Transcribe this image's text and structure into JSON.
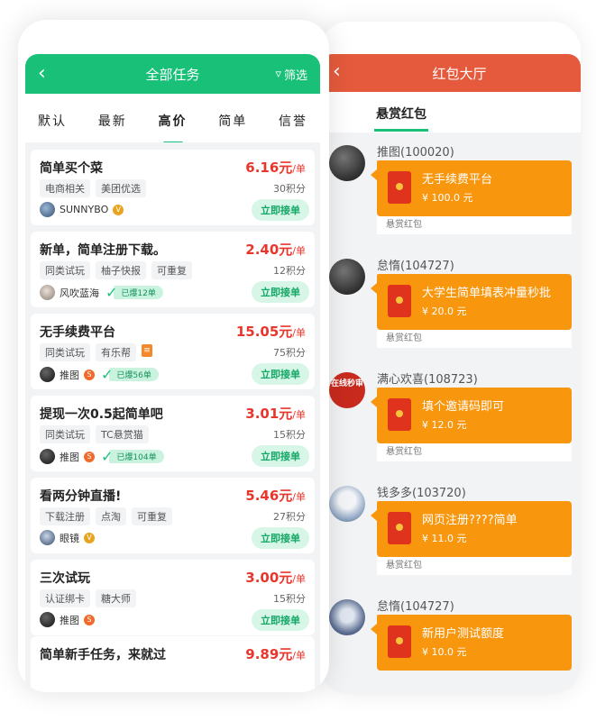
{
  "left": {
    "back_icon": "chevron-left-icon",
    "title": "全部任务",
    "filter_label": "筛选",
    "tabs": [
      "默认",
      "最新",
      "高价",
      "简单",
      "信誉"
    ],
    "active_tab": "高价",
    "tasks": [
      {
        "title": "简单买个菜",
        "price": "6.16元",
        "unit": "/单",
        "tags": [
          "电商相关",
          "美团优选"
        ],
        "points": "30积分",
        "user": "SUNNYBO",
        "badge": "V",
        "sold": "",
        "action": "立即接单"
      },
      {
        "title": "新单，简单注册下载。",
        "price": "2.40元",
        "unit": "/单",
        "tags": [
          "同类试玩",
          "柚子快报",
          "可重复"
        ],
        "points": "12积分",
        "user": "风吹蓝海",
        "badge": "",
        "sold": "已爆12单",
        "action": "立即接单"
      },
      {
        "title": "无手续费平台",
        "price": "15.05元",
        "unit": "/单",
        "tags": [
          "同类试玩",
          "有乐帮"
        ],
        "points": "75积分",
        "user": "推图",
        "badge": "S",
        "sold": "已爆56单",
        "action": "立即接单"
      },
      {
        "title": "提现一次0.5起简单吧",
        "price": "3.01元",
        "unit": "/单",
        "tags": [
          "同类试玩",
          "TC悬赏猫"
        ],
        "points": "15积分",
        "user": "推图",
        "badge": "S",
        "sold": "已爆104单",
        "action": "立即接单"
      },
      {
        "title": "看两分钟直播!",
        "price": "5.46元",
        "unit": "/单",
        "tags": [
          "下载注册",
          "点淘",
          "可重复"
        ],
        "points": "27积分",
        "user": "眼镜",
        "badge": "V",
        "sold": "",
        "action": "立即接单"
      },
      {
        "title": "三次试玩",
        "price": "3.00元",
        "unit": "/单",
        "tags": [
          "认证绑卡",
          "糖大师"
        ],
        "points": "15积分",
        "user": "推图",
        "badge": "S",
        "sold": "",
        "action": "立即接单"
      }
    ],
    "last_task": {
      "title": "简单新手任务，来就过",
      "price": "9.89元",
      "unit": "/单"
    }
  },
  "right": {
    "back_icon": "chevron-left-icon",
    "title": "红包大厅",
    "tab": "悬赏红包",
    "messages": [
      {
        "name": "推图(100020)",
        "text": "无手续费平台",
        "amount": "¥ 100.0 元",
        "footer": "悬赏红包"
      },
      {
        "name": "怠惰(104727)",
        "text": "大学生简单填表冲量秒批",
        "amount": "¥ 20.0 元",
        "footer": "悬赏红包"
      },
      {
        "name": "满心欢喜(108723)",
        "text": "填个邀请码即可",
        "amount": "¥ 12.0 元",
        "footer": "悬赏红包",
        "avatar_text": "在线秒审"
      },
      {
        "name": "钱多多(103720)",
        "text": "网页注册????简单",
        "amount": "¥ 11.0 元",
        "footer": "悬赏红包"
      },
      {
        "name": "怠惰(104727)",
        "text": "新用户测试额度",
        "amount": "¥ 10.0 元",
        "footer": ""
      }
    ]
  }
}
